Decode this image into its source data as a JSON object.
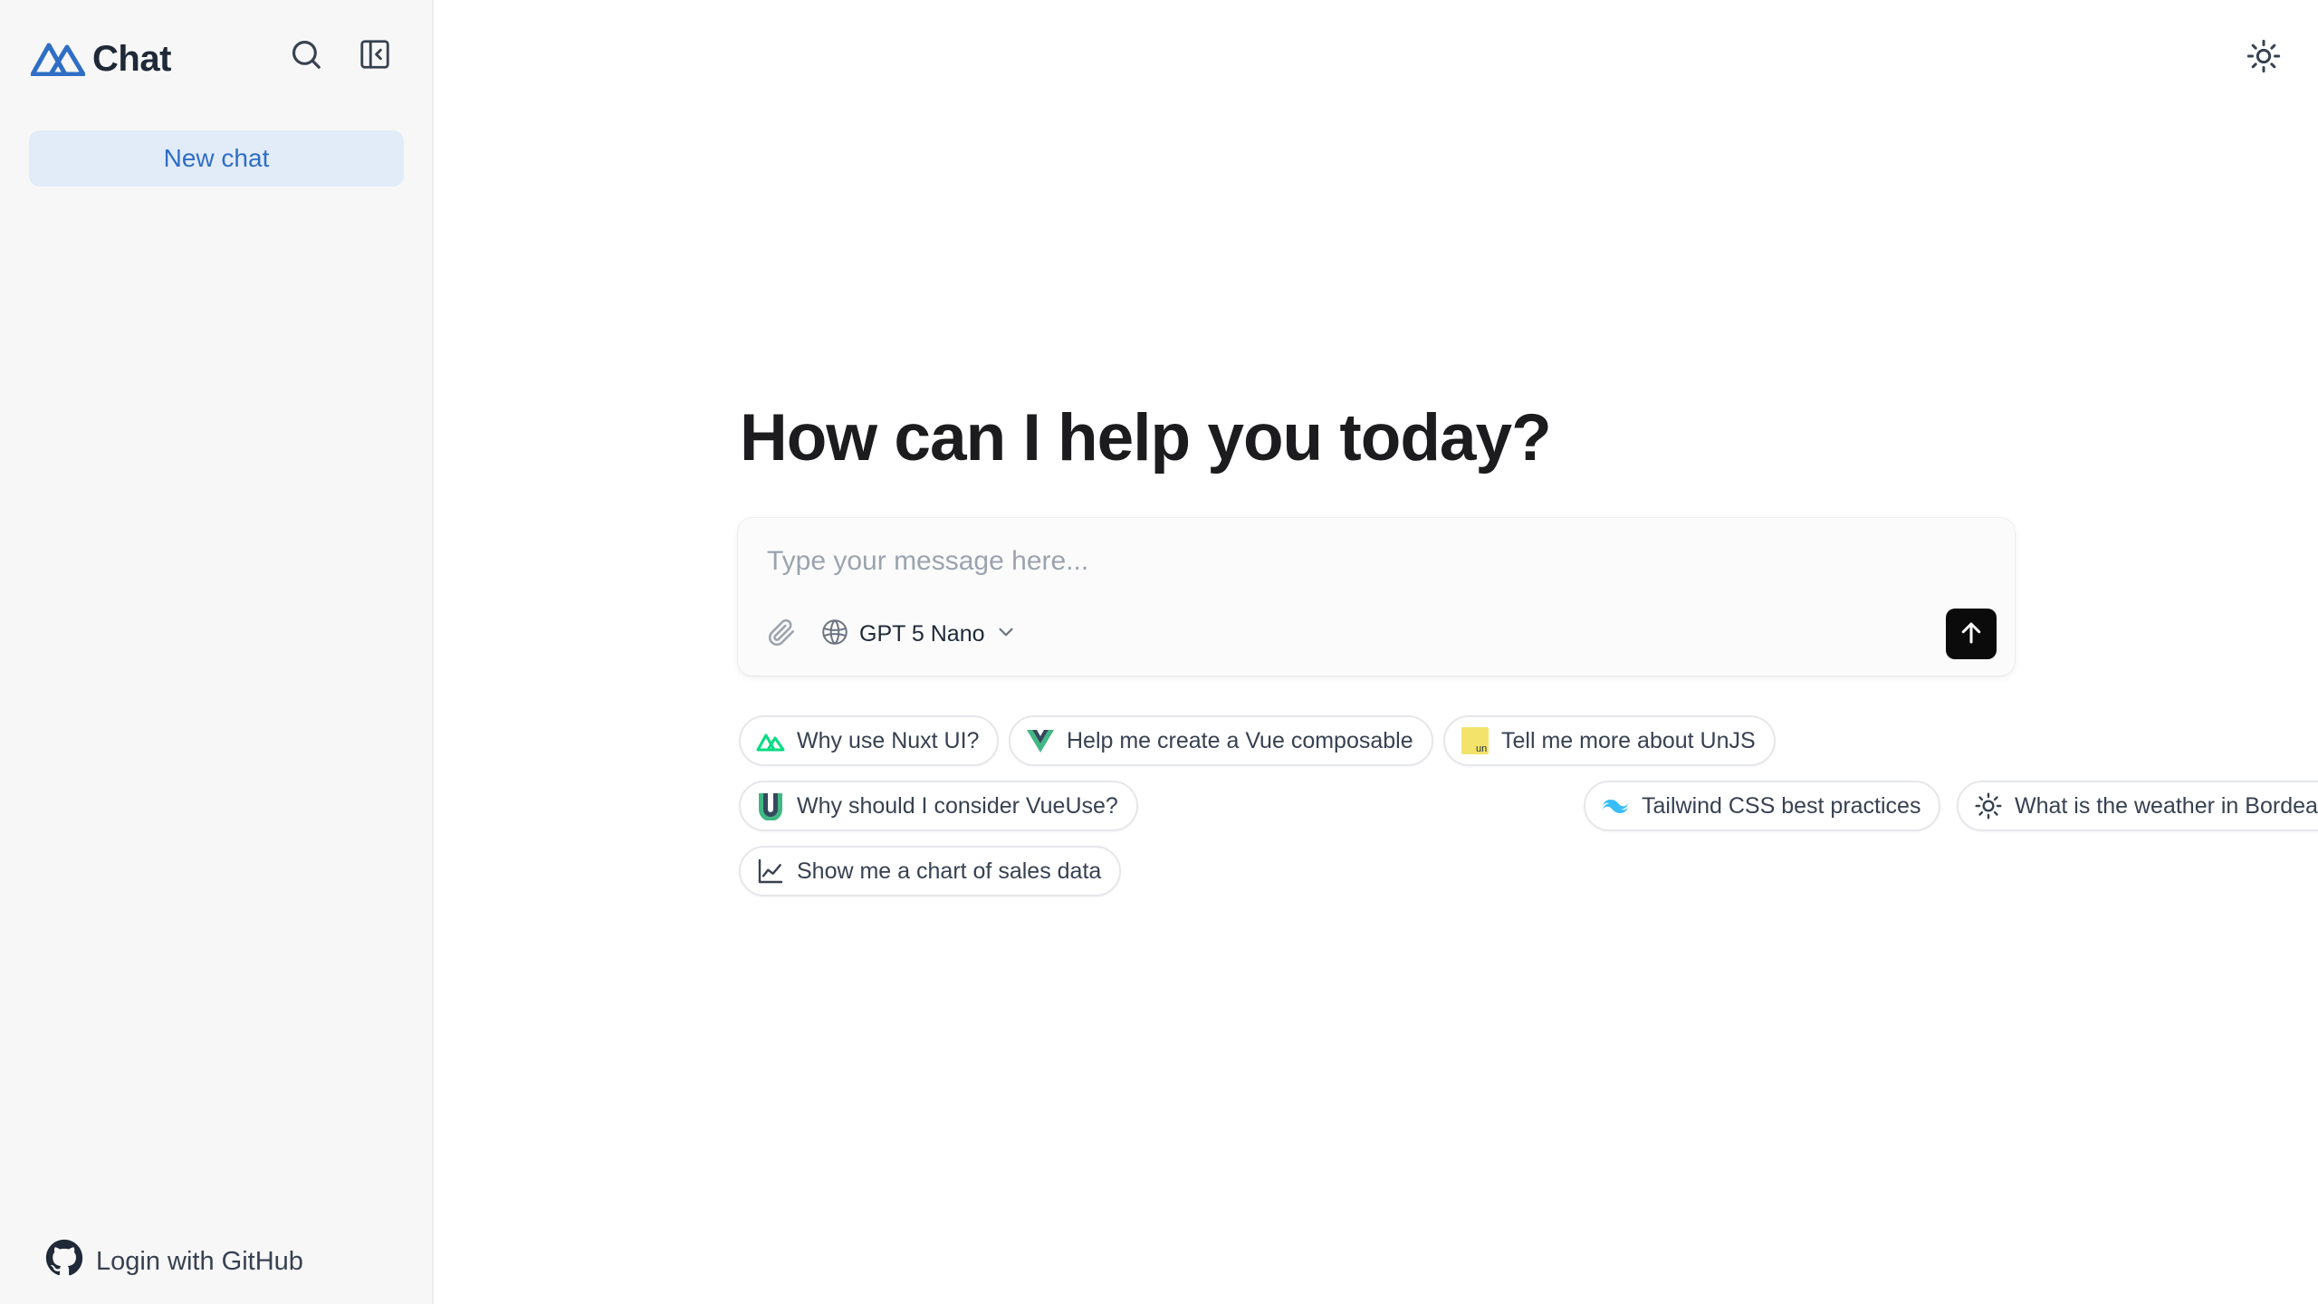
{
  "sidebar": {
    "brand_name": "Chat",
    "new_chat_label": "New chat",
    "login_label": "Login with GitHub"
  },
  "main": {
    "heading": "How can I help you today?",
    "composer": {
      "placeholder": "Type your message here...",
      "model_label": "GPT 5 Nano"
    },
    "suggestions": [
      {
        "label": "Why use Nuxt UI?",
        "icon": "nuxt-icon"
      },
      {
        "label": "Help me create a Vue composable",
        "icon": "vue-icon"
      },
      {
        "label": "Tell me more about UnJS",
        "icon": "unjs-icon"
      },
      {
        "label": "Why should I consider VueUse?",
        "icon": "vueuse-icon"
      },
      {
        "label": "Tailwind CSS best practices",
        "icon": "tailwind-icon"
      },
      {
        "label": "What is the weather in Bordeaux?",
        "icon": "sun-icon"
      },
      {
        "label": "Show me a chart of sales data",
        "icon": "chart-icon"
      }
    ]
  },
  "colors": {
    "accent": "#2f6ec4",
    "nuxt_green": "#00dc82",
    "vue_green": "#41b883",
    "tailwind_cyan": "#38bdf8",
    "unjs_yellow": "#f4e36b"
  }
}
